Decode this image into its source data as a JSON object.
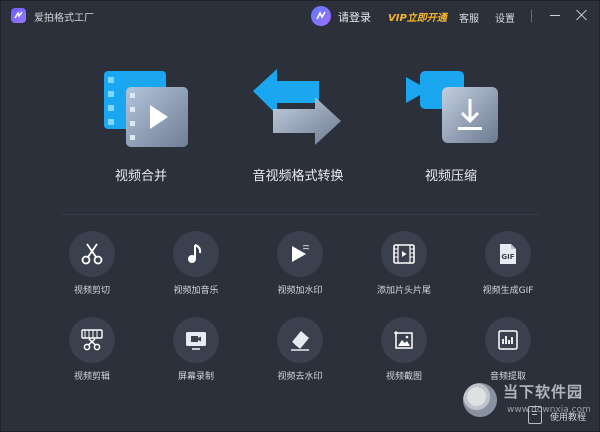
{
  "titlebar": {
    "app_title": "爱拍格式工厂",
    "login": "请登录",
    "vip": "VIP立即开通",
    "service": "客服",
    "settings": "设置"
  },
  "features": [
    {
      "label": "视频合并",
      "icon": "video-merge-icon"
    },
    {
      "label": "音视频格式转换",
      "icon": "format-convert-icon"
    },
    {
      "label": "视频压缩",
      "icon": "video-compress-icon"
    }
  ],
  "tools": [
    {
      "label": "视频剪切",
      "icon": "scissors-icon"
    },
    {
      "label": "视频加音乐",
      "icon": "music-note-icon"
    },
    {
      "label": "视频加水印",
      "icon": "play-watermark-icon"
    },
    {
      "label": "添加片头片尾",
      "icon": "film-strip-icon"
    },
    {
      "label": "视频生成GIF",
      "icon": "gif-file-icon"
    },
    {
      "label": "视频剪辑",
      "icon": "film-cut-icon"
    },
    {
      "label": "屏幕录制",
      "icon": "screen-record-icon"
    },
    {
      "label": "视频去水印",
      "icon": "eraser-icon"
    },
    {
      "label": "视频截图",
      "icon": "screenshot-image-icon"
    },
    {
      "label": "音频提取",
      "icon": "audio-extract-icon"
    }
  ],
  "footer": {
    "help": "使用教程",
    "watermark_brand": "当下软件园",
    "watermark_url": "www.downxia.com"
  },
  "colors": {
    "background": "#2c303b",
    "accent": "#1fb0f5",
    "vip": "#f5b52a"
  }
}
